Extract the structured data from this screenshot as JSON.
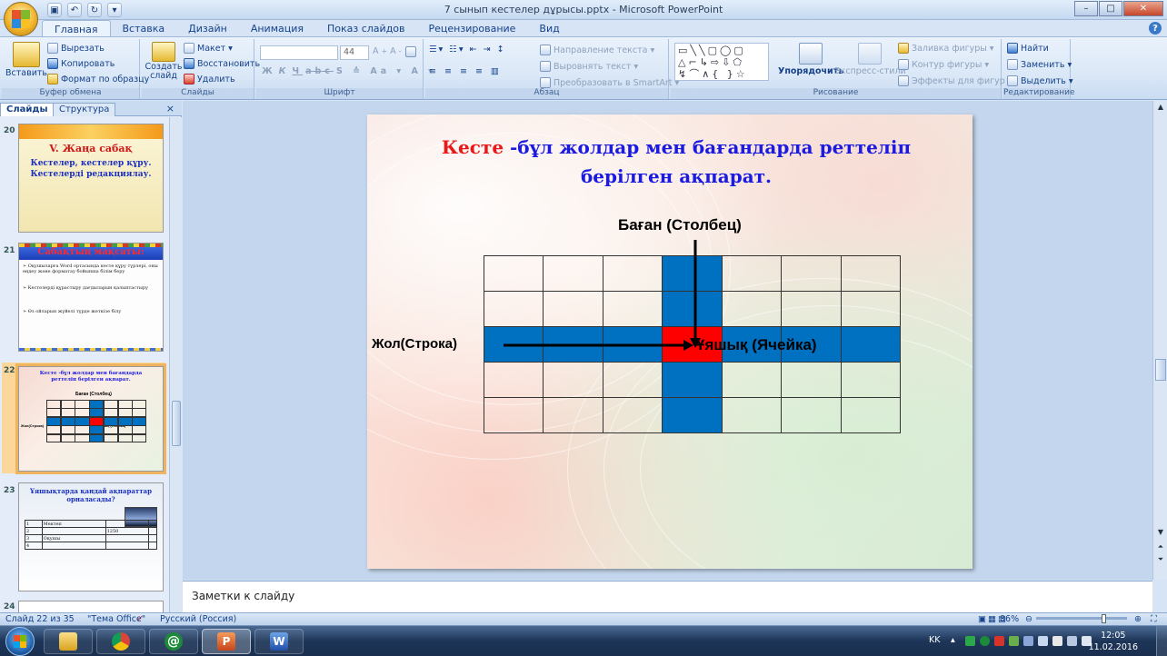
{
  "window": {
    "title": "7 сынып кестелер дұрысы.pptx - Microsoft PowerPoint",
    "minimize": "–",
    "maximize": "□",
    "close": "✕"
  },
  "ribbon_tabs": [
    "Главная",
    "Вставка",
    "Дизайн",
    "Анимация",
    "Показ слайдов",
    "Рецензирование",
    "Вид"
  ],
  "ribbon": {
    "clipboard": {
      "paste": "Вставить",
      "cut": "Вырезать",
      "copy": "Копировать",
      "format_painter": "Формат по образцу",
      "label": "Буфер обмена"
    },
    "slides": {
      "new_slide": "Создать слайд",
      "layout": "Макет",
      "reset": "Восстановить",
      "delete": "Удалить",
      "label": "Слайды"
    },
    "font": {
      "font_name": "",
      "font_size": "44",
      "label": "Шрифт"
    },
    "paragraph": {
      "text_direction": "Направление текста",
      "align_text": "Выровнять текст",
      "smartart": "Преобразовать в SmartArt",
      "label": "Абзац"
    },
    "drawing": {
      "arrange": "Упорядочить",
      "quick_styles": "Экспресс-стили",
      "shape_fill": "Заливка фигуры",
      "shape_outline": "Контур фигуры",
      "shape_effects": "Эффекты для фигур",
      "label": "Рисование"
    },
    "editing": {
      "find": "Найти",
      "replace": "Заменить",
      "select": "Выделить",
      "label": "Редактирование"
    }
  },
  "left_pane": {
    "tab_slides": "Слайды",
    "tab_outline": "Структура",
    "close": "×",
    "thumbs": [
      {
        "num": "20",
        "title": "V. Жаңа сабақ",
        "lines": [
          "Кестелер, кестелер құру.",
          "Кестелерді редакциялау."
        ]
      },
      {
        "num": "21",
        "title": "Сабақтың мақсаты:",
        "lines": [
          "➢ Оқушыларға Word ортасында кесте құру түрлері, оны өңдеу және форматау бойынша білім беру",
          "➢ Кестелерді құрастыру дағдыларын қалыптастыру",
          "➢ Өз ойларын жүйелі түрде жеткізе білу"
        ]
      },
      {
        "num": "22",
        "title": "Кесте -бұл жолдар мен бағандарда реттеліп берілген ақпарат.",
        "col": "Баған (Столбец)",
        "row": "Жол(Строка)",
        "cell": "Ұяшық (Ячейка)"
      },
      {
        "num": "23",
        "title": "Ұяшықтарда қандай ақпараттар орналасады?",
        "rows": [
          [
            "1",
            "Мектеп"
          ],
          [
            "2",
            "1250"
          ],
          [
            "3",
            "Оқушы"
          ],
          [
            "4",
            ""
          ]
        ]
      },
      {
        "num": "24"
      }
    ]
  },
  "slide": {
    "title_red": "Кесте",
    "title_blue": " -бұл жолдар мен бағандарда реттеліп берілген ақпарат.",
    "column_label": "Баған (Столбец)",
    "row_label": "Жол(Строка)",
    "cell_label": "Ұяшық (Ячейка)",
    "table": {
      "rows": 5,
      "cols": 7,
      "highlight_row": 3,
      "highlight_col": 4
    },
    "colors": {
      "highlight": "#0070c0",
      "cell": "#ff0000",
      "title_red": "#e81818",
      "title_blue": "#1a1ae0"
    }
  },
  "notes": {
    "placeholder": "Заметки к слайду"
  },
  "status": {
    "slide_info": "Слайд 22 из 35",
    "theme": "\"Тема Office\"",
    "language": "Русский (Россия)",
    "zoom": "86%"
  },
  "taskbar": {
    "tray_lang": "KK",
    "time": "12:05",
    "date": "11.02.2016"
  }
}
